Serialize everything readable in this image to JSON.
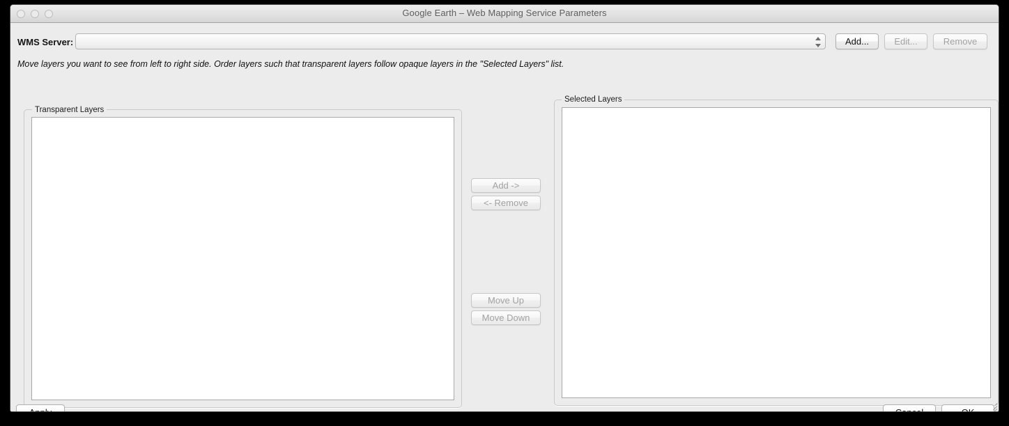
{
  "window": {
    "title": "Google Earth – Web Mapping Service Parameters",
    "traffic_lights": [
      "close",
      "minimize",
      "zoom"
    ]
  },
  "server_row": {
    "label": "WMS Server:",
    "combo_value": "",
    "combo_placeholder": "",
    "buttons": {
      "add": "Add...",
      "edit": "Edit...",
      "remove": "Remove"
    }
  },
  "hint": "Move layers you want to see from left to right side. Order layers such that transparent layers follow opaque layers in the \"Selected Layers\" list.",
  "transparent_layers": {
    "title": "Transparent Layers",
    "items": []
  },
  "selected_layers": {
    "title": "Selected Layers",
    "items": []
  },
  "transfer_buttons": {
    "add": "Add ->",
    "remove": "<- Remove",
    "move_up": "Move Up",
    "move_down": "Move Down"
  },
  "footer": {
    "apply": "Apply",
    "cancel": "Cancel",
    "ok": "OK"
  },
  "colors": {
    "window_bg": "#ececec",
    "titlebar_top": "#ededed",
    "titlebar_bottom": "#d6d6d6",
    "title_text": "#5e5e5e",
    "text": "#101010",
    "disabled_text": "#a2a2a2",
    "list_bg": "#ffffff",
    "border": "#b0b0b0",
    "desktop": "#000000"
  }
}
